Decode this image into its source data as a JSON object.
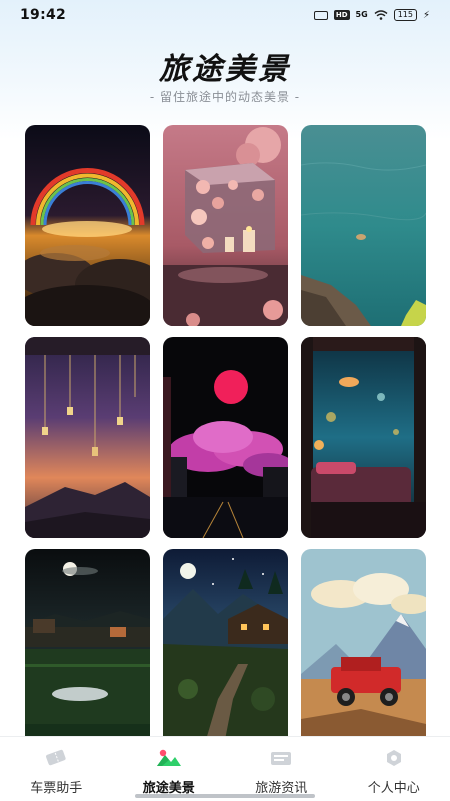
{
  "status_bar": {
    "time": "19:42",
    "network": "HD",
    "signal": "5G",
    "battery": "115"
  },
  "header": {
    "title": "旅途美景",
    "subtitle": "- 留住旅途中的动态美景 -"
  },
  "gallery": {
    "items": [
      {
        "name": "rainbow-clouds"
      },
      {
        "name": "flower-cube-candles"
      },
      {
        "name": "turquoise-sea"
      },
      {
        "name": "sunset-wind-chimes"
      },
      {
        "name": "pink-moon-city"
      },
      {
        "name": "underwater-bedroom"
      },
      {
        "name": "moonlit-rice-field"
      },
      {
        "name": "night-cabin-stairs"
      },
      {
        "name": "red-jeep-mountains"
      }
    ]
  },
  "tabbar": {
    "tabs": [
      {
        "label": "车票助手",
        "icon": "ticket-icon",
        "active": false
      },
      {
        "label": "旅途美景",
        "icon": "scenery-icon",
        "active": true
      },
      {
        "label": "旅游资讯",
        "icon": "news-icon",
        "active": false
      },
      {
        "label": "个人中心",
        "icon": "profile-icon",
        "active": false
      }
    ]
  }
}
